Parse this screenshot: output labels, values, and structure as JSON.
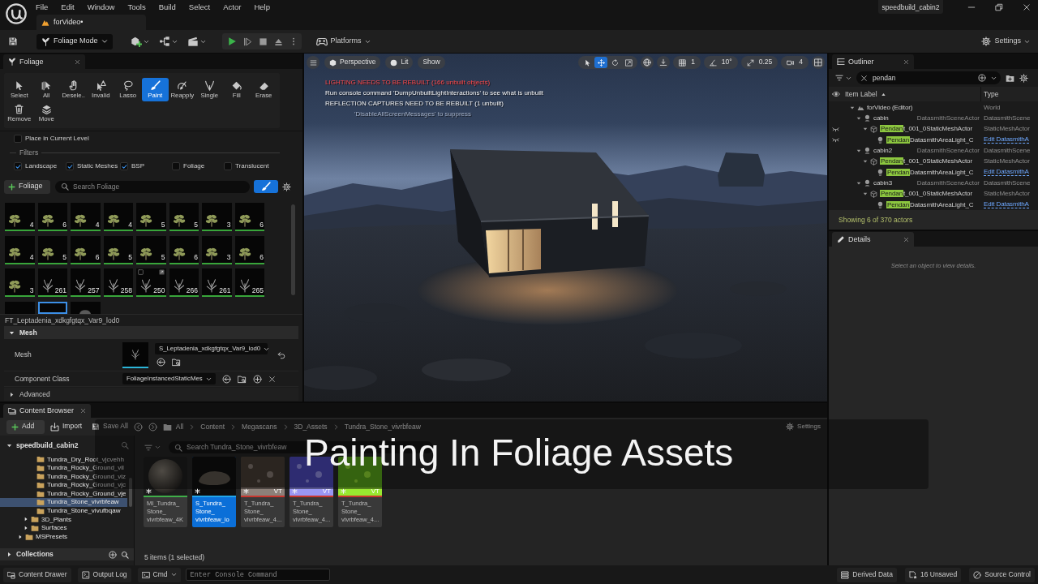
{
  "menu_bar": {
    "items": [
      "File",
      "Edit",
      "Window",
      "Tools",
      "Build",
      "Select",
      "Actor",
      "Help"
    ],
    "project": "speedbuild_cabin2"
  },
  "document_tabs": [
    {
      "label": "forVideo•",
      "selected": true
    }
  ],
  "toolbar": {
    "mode": "Foliage Mode",
    "platforms": "Platforms",
    "settings": "Settings"
  },
  "foliage_panel": {
    "tab": "Foliage",
    "tools": [
      {
        "label": "Select",
        "selected": false
      },
      {
        "label": "All",
        "selected": false
      },
      {
        "label": "Desele..",
        "selected": false
      },
      {
        "label": "Invalid",
        "selected": false
      },
      {
        "label": "Lasso",
        "selected": false
      },
      {
        "label": "Paint",
        "selected": true
      },
      {
        "label": "Reapply",
        "selected": false
      },
      {
        "label": "Single",
        "selected": false
      },
      {
        "label": "Fill",
        "selected": false
      },
      {
        "label": "Erase",
        "selected": false
      },
      {
        "label": "Remove",
        "selected": false
      },
      {
        "label": "Move",
        "selected": false
      }
    ],
    "place_in_current_level": {
      "label": "Place in Current Level",
      "checked": false
    },
    "filters_heading": "Filters",
    "filters": [
      {
        "label": "Landscape",
        "checked": true
      },
      {
        "label": "Static Meshes",
        "checked": true
      },
      {
        "label": "BSP",
        "checked": true
      },
      {
        "label": "Foliage",
        "checked": false
      },
      {
        "label": "Translucent",
        "checked": false
      }
    ],
    "add_button": "Foliage",
    "search": {
      "placeholder": "Search Foliage"
    },
    "paint_filter": {
      "on": true
    },
    "foliage_types": [
      {
        "kind": "leafy",
        "count": "4",
        "active": true,
        "selected": false,
        "hovered": false
      },
      {
        "kind": "leafy",
        "count": "6",
        "active": true,
        "selected": false,
        "hovered": false
      },
      {
        "kind": "leafy",
        "count": "4",
        "active": true,
        "selected": false,
        "hovered": false
      },
      {
        "kind": "leafy",
        "count": "4",
        "active": true,
        "selected": false,
        "hovered": false
      },
      {
        "kind": "leafy",
        "count": "5",
        "active": true,
        "selected": false,
        "hovered": false
      },
      {
        "kind": "leafy",
        "count": "5",
        "active": true,
        "selected": false,
        "hovered": false
      },
      {
        "kind": "leafy",
        "count": "3",
        "active": true,
        "selected": false,
        "hovered": false
      },
      {
        "kind": "leafy",
        "count": "6",
        "active": true,
        "selected": false,
        "hovered": false
      },
      {
        "kind": "leafy",
        "count": "4",
        "active": true,
        "selected": false,
        "hovered": false
      },
      {
        "kind": "leafy",
        "count": "5",
        "active": true,
        "selected": false,
        "hovered": false
      },
      {
        "kind": "leafy",
        "count": "6",
        "active": true,
        "selected": false,
        "hovered": false
      },
      {
        "kind": "leafy",
        "count": "5",
        "active": true,
        "selected": false,
        "hovered": false
      },
      {
        "kind": "leafy",
        "count": "5",
        "active": true,
        "selected": false,
        "hovered": false
      },
      {
        "kind": "leafy",
        "count": "6",
        "active": true,
        "selected": false,
        "hovered": false
      },
      {
        "kind": "leafy",
        "count": "3",
        "active": true,
        "selected": false,
        "hovered": false
      },
      {
        "kind": "leafy",
        "count": "6",
        "active": true,
        "selected": false,
        "hovered": false
      },
      {
        "kind": "leafy",
        "count": "3",
        "active": true,
        "selected": false,
        "hovered": false
      },
      {
        "kind": "sparse",
        "count": "261",
        "active": true,
        "selected": false,
        "hovered": false
      },
      {
        "kind": "sparse",
        "count": "257",
        "active": true,
        "selected": false,
        "hovered": false
      },
      {
        "kind": "sparse",
        "count": "258",
        "active": true,
        "selected": false,
        "hovered": false
      },
      {
        "kind": "sparse",
        "count": "250",
        "active": true,
        "selected": false,
        "hovered": true
      },
      {
        "kind": "sparse",
        "count": "266",
        "active": true,
        "selected": false,
        "hovered": false
      },
      {
        "kind": "sparse",
        "count": "261",
        "active": true,
        "selected": false,
        "hovered": false
      },
      {
        "kind": "sparse",
        "count": "265",
        "active": true,
        "selected": false,
        "hovered": false
      },
      {
        "kind": "blank",
        "active": false,
        "selected": false,
        "hovered": false
      },
      {
        "kind": "blank",
        "active": false,
        "selected": true,
        "hovered": false
      },
      {
        "kind": "rock",
        "active": false,
        "selected": false,
        "hovered": false
      }
    ],
    "selected_type": "FT_Leptadenia_xdkgfgtqx_Var9_lod0",
    "sections": [
      {
        "title": "Mesh",
        "kind": "category",
        "expanded": true,
        "rows": [
          {
            "label": "Mesh",
            "kind": "asset",
            "value": "S_Leptadenia_xdkgfgtqx_Var9_lod0"
          },
          {
            "label": "Component Class",
            "kind": "class",
            "value": "FoliageInstancedStaticMes"
          }
        ]
      },
      {
        "title": "Advanced",
        "kind": "group",
        "expanded": false
      }
    ]
  },
  "viewport": {
    "view_buttons": [
      "Perspective",
      "Lit",
      "Show"
    ],
    "messages": [
      {
        "kind": "error",
        "text": "LIGHTING NEEDS TO BE REBUILT (166 unbuilt objects)"
      },
      {
        "kind": "info",
        "text": "Run console command 'DumpUnbuiltLightInteractions' to see what is unbuilt"
      },
      {
        "kind": "info",
        "text": "REFLECTION CAPTURES NEED TO BE REBUILT (1 unbuilt)"
      },
      {
        "kind": "hint",
        "text": "'DisableAllScreenMessages' to suppress"
      }
    ],
    "transform_tools": [
      {
        "selected": false
      },
      {
        "selected": true
      },
      {
        "selected": false
      },
      {
        "selected": false
      }
    ],
    "grid_snap": "1",
    "angle_snap": "10°",
    "scale_snap": "0.25",
    "camera_speed": "4"
  },
  "outliner": {
    "tab": "Outliner",
    "search": {
      "value": "pendan"
    },
    "columns": [
      {
        "label": "Item Label",
        "sorted": true
      },
      {
        "label": "Type",
        "sorted": false
      }
    ],
    "tree": [
      {
        "label": "forVideo (Editor)",
        "kind": "world",
        "type": "World",
        "expanded": true,
        "eye": false,
        "children": [
          {
            "label": "cabin",
            "kind": "scene",
            "detail": "DatasmithSceneActor",
            "type": "DatasmithScene",
            "expanded": true,
            "eye": false,
            "children": [
              {
                "match": "Pendan",
                "label": "t_001_0StaticMeshActor",
                "kind": "mesh",
                "type": "StaticMeshActor",
                "expanded": true,
                "eye": true,
                "children": [
                  {
                    "match": "Pendan",
                    "label": "DatasmithAreaLight_C",
                    "kind": "light",
                    "link": "Edit DatasmithA",
                    "eye": true
                  }
                ]
              }
            ]
          },
          {
            "label": "cabin2",
            "kind": "scene",
            "detail": "DatasmithSceneActor",
            "type": "DatasmithScene",
            "expanded": true,
            "eye": false,
            "children": [
              {
                "match": "Pendan",
                "label": "t_001_0StaticMeshActor",
                "kind": "mesh",
                "type": "StaticMeshActor",
                "expanded": true,
                "eye": false,
                "children": [
                  {
                    "match": "Pendan",
                    "label": "DatasmithAreaLight_C",
                    "kind": "light",
                    "link": "Edit DatasmithA",
                    "eye": false
                  }
                ]
              }
            ]
          },
          {
            "label": "cabin3",
            "kind": "scene",
            "detail": "DatasmithSceneActor",
            "type": "DatasmithScene",
            "expanded": true,
            "eye": false,
            "children": [
              {
                "match": "Pendan",
                "label": "t_001_0StaticMeshActor",
                "kind": "mesh",
                "type": "StaticMeshActor",
                "expanded": true,
                "eye": false,
                "children": [
                  {
                    "match": "Pendan",
                    "label": "DatasmithAreaLight_C",
                    "kind": "light",
                    "link": "Edit DatasmithA",
                    "eye": false
                  }
                ]
              }
            ]
          }
        ]
      }
    ],
    "status": "Showing 6 of 370 actors"
  },
  "details": {
    "tab": "Details",
    "empty_message": "Select an object to view details."
  },
  "content_browser": {
    "tab": "Content Browser",
    "add_button": "Add",
    "import_button": "Import",
    "save_all_button": "Save All",
    "breadcrumbs": [
      "All",
      "Content",
      "Megascans",
      "3D_Assets",
      "Tundra_Stone_vivrbfeaw"
    ],
    "settings": "Settings",
    "root": {
      "label": "speedbuild_cabin2",
      "expanded": true
    },
    "folders": [
      {
        "children": [
          {
            "children": [
              {
                "label": "Tundra_Dry_Root_vjcvehh",
                "selected": false
              },
              {
                "label": "Tundra_Rocky_Ground_vil",
                "selected": false
              },
              {
                "label": "Tundra_Rocky_Ground_viz",
                "selected": false
              },
              {
                "label": "Tundra_Rocky_Ground_vjc",
                "selected": false
              },
              {
                "label": "Tundra_Rocky_Ground_vje",
                "selected": false
              },
              {
                "label": "Tundra_Stone_vivrbfeaw",
                "selected": true
              },
              {
                "label": "Tundra_Stone_vivufbqaw",
                "selected": false
              }
            ]
          },
          {
            "label": "3D_Plants",
            "expanded": false,
            "selected": false
          },
          {
            "label": "Surfaces",
            "expanded": false,
            "selected": false
          }
        ]
      },
      {
        "label": "MSPresets",
        "expanded": false,
        "selected": false
      }
    ],
    "collections": {
      "label": "Collections",
      "expanded": false
    },
    "search": {
      "placeholder": "Search Tundra_Stone_vivrbfeaw"
    },
    "assets": [
      {
        "kind": "material",
        "label": "MI_Tundra_\nStone_\nvivrbfeaw_4K",
        "color": "#3fae49",
        "selected": false
      },
      {
        "kind": "mesh",
        "label": "S_Tundra_\nStone_\nvivrbfeaw_lo",
        "color": "#22a6e8",
        "selected": true
      },
      {
        "kind": "texture",
        "label": "T_Tundra_\nStone_\nvivrbfeaw_4...",
        "badge": "VT",
        "color": "#c8362e",
        "selected": false
      },
      {
        "kind": "texture",
        "label": "T_Tundra_\nStone_\nvivrbfeaw_4...",
        "badge": "VT",
        "color": "#c8362e",
        "selected": false
      },
      {
        "kind": "texture",
        "label": "T_Tundra_\nStone_\nvivrbfeaw_4...",
        "badge": "VT",
        "color": "#c8362e",
        "selected": false
      }
    ],
    "status": "5 items (1 selected)"
  },
  "caption": {
    "text": "Painting In Foliage Assets"
  },
  "status_bar": {
    "content_drawer": "Content Drawer",
    "output_log": "Output Log",
    "cmd": "Cmd",
    "console": {
      "placeholder": "Enter Console Command"
    },
    "derived_data": "Derived Data",
    "unsaved": "16 Unsaved",
    "source_control": "Source Control"
  }
}
